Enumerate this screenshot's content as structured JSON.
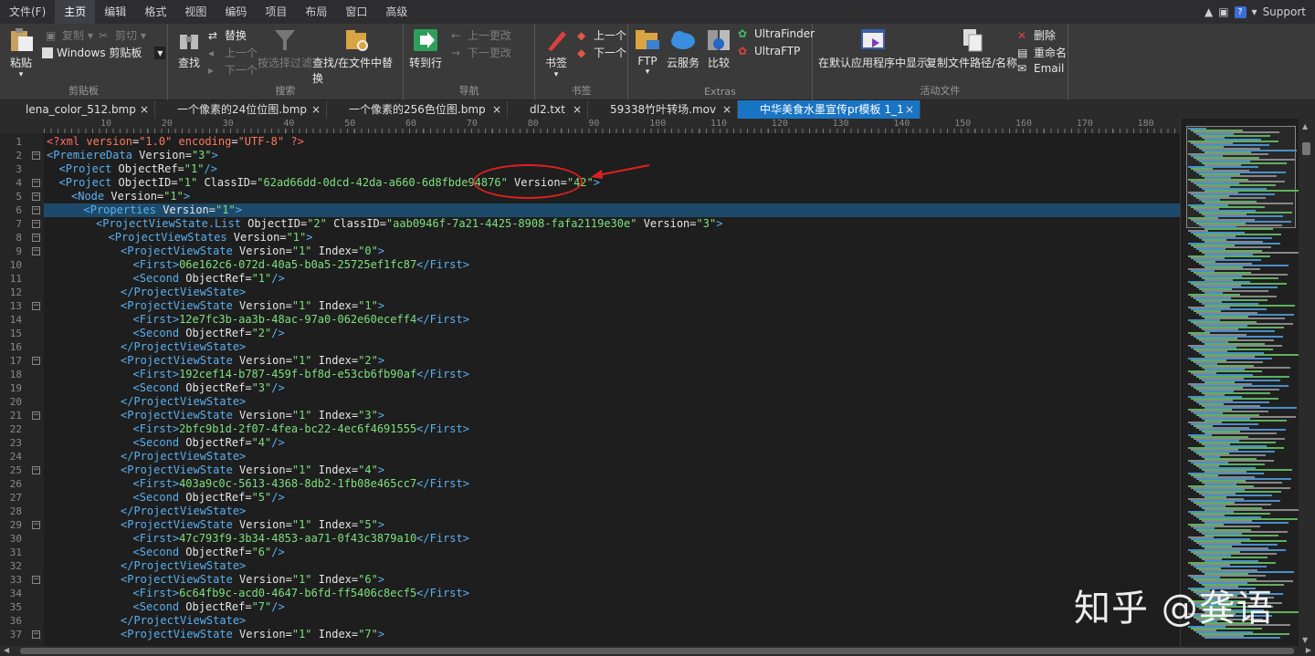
{
  "menu": {
    "items": [
      "文件(F)",
      "主页",
      "编辑",
      "格式",
      "视图",
      "编码",
      "项目",
      "布局",
      "窗口",
      "高级"
    ],
    "active_index": 1,
    "support": "Support"
  },
  "ribbon": {
    "clipboard": {
      "paste": "粘贴",
      "copy": "复制",
      "cut": "剪切",
      "windows_clipboard": "Windows 剪贴板",
      "label": "剪贴板"
    },
    "search": {
      "find": "查找",
      "replace": "替换",
      "prev": "上一个",
      "next": "下一个",
      "filter": "按选择过滤",
      "find_in_files": "查找/在文件中替换",
      "label": "搜索"
    },
    "navigation": {
      "goto": "转到行",
      "prev_change": "上一更改",
      "next_change": "下一更改",
      "label": "导航"
    },
    "bookmarks": {
      "bookmark": "书签",
      "prev": "上一个",
      "next": "下一个",
      "label": "书签"
    },
    "extras": {
      "ftp": "FTP",
      "cloud": "云服务",
      "compare": "比较",
      "ultrafinder": "UltraFinder",
      "ultraftp": "UltraFTP",
      "label": "Extras"
    },
    "active_file": {
      "show_default": "在默认应用程序中显示",
      "copy_path": "复制文件路径/名称",
      "delete": "删除",
      "rename": "重命名",
      "email": "Email",
      "label": "活动文件"
    }
  },
  "tabs": [
    {
      "label": "lena_color_512.bmp",
      "active": false
    },
    {
      "label": "一个像素的24位位图.bmp",
      "active": false
    },
    {
      "label": "一个像素的256色位图.bmp",
      "active": false
    },
    {
      "label": "dl2.txt",
      "active": false
    },
    {
      "label": "59338竹叶转场.mov",
      "active": false
    },
    {
      "label": "中华美食水墨宣传pr模板 1_1",
      "active": true
    }
  ],
  "ruler": [
    "10",
    "20",
    "30",
    "40",
    "50",
    "60",
    "70",
    "80",
    "90",
    "100",
    "110",
    "120",
    "130",
    "140",
    "150",
    "160",
    "170",
    "180"
  ],
  "editor": {
    "current_line": 6,
    "lines": [
      {
        "n": "1",
        "indent": 0,
        "fold": "",
        "tokens": [
          [
            "pi",
            "<?xml "
          ],
          [
            "str",
            "version"
          ],
          [
            "t",
            "="
          ],
          [
            "str",
            "\"1.0\""
          ],
          [
            "t",
            " "
          ],
          [
            "str",
            "encoding"
          ],
          [
            "t",
            "="
          ],
          [
            "str",
            "\"UTF-8\""
          ],
          [
            "pi",
            " ?>"
          ]
        ]
      },
      {
        "n": "2",
        "indent": 0,
        "fold": "−",
        "tokens": [
          [
            "tag",
            "<PremiereData"
          ],
          [
            "t",
            " Version="
          ],
          [
            "val",
            "\"3\""
          ],
          [
            "tag",
            ">"
          ]
        ]
      },
      {
        "n": "3",
        "indent": 1,
        "fold": "",
        "tokens": [
          [
            "tag",
            "<Project"
          ],
          [
            "t",
            " ObjectRef="
          ],
          [
            "val",
            "\"1\""
          ],
          [
            "tag",
            "/>"
          ]
        ]
      },
      {
        "n": "4",
        "indent": 1,
        "fold": "−",
        "tokens": [
          [
            "tag",
            "<Project"
          ],
          [
            "t",
            " ObjectID="
          ],
          [
            "val",
            "\"1\""
          ],
          [
            "t",
            " ClassID="
          ],
          [
            "val",
            "\"62ad66dd-0dcd-42da-a660-6d8fbde94876\""
          ],
          [
            "t",
            " Version="
          ],
          [
            "val",
            "\"42\""
          ],
          [
            "tag",
            ">"
          ]
        ]
      },
      {
        "n": "5",
        "indent": 2,
        "fold": "−",
        "tokens": [
          [
            "tag",
            "<Node"
          ],
          [
            "t",
            " Version="
          ],
          [
            "val",
            "\"1\""
          ],
          [
            "tag",
            ">"
          ]
        ]
      },
      {
        "n": "6",
        "indent": 3,
        "fold": "−",
        "tokens": [
          [
            "tag",
            "<Properties"
          ],
          [
            "t",
            " Version="
          ],
          [
            "val",
            "\"1\""
          ],
          [
            "tag",
            ">"
          ]
        ]
      },
      {
        "n": "7",
        "indent": 4,
        "fold": "−",
        "tokens": [
          [
            "tag",
            "<ProjectViewState.List"
          ],
          [
            "t",
            " ObjectID="
          ],
          [
            "val",
            "\"2\""
          ],
          [
            "t",
            " ClassID="
          ],
          [
            "val",
            "\"aab0946f-7a21-4425-8908-fafa2119e30e\""
          ],
          [
            "t",
            " Version="
          ],
          [
            "val",
            "\"3\""
          ],
          [
            "tag",
            ">"
          ]
        ]
      },
      {
        "n": "8",
        "indent": 5,
        "fold": "−",
        "tokens": [
          [
            "tag",
            "<ProjectViewStates"
          ],
          [
            "t",
            " Version="
          ],
          [
            "val",
            "\"1\""
          ],
          [
            "tag",
            ">"
          ]
        ]
      },
      {
        "n": "9",
        "indent": 6,
        "fold": "−",
        "tokens": [
          [
            "tag",
            "<ProjectViewState"
          ],
          [
            "t",
            " Version="
          ],
          [
            "val",
            "\"1\""
          ],
          [
            "t",
            " Index="
          ],
          [
            "val",
            "\"0\""
          ],
          [
            "tag",
            ">"
          ]
        ]
      },
      {
        "n": "10",
        "indent": 7,
        "fold": "",
        "tokens": [
          [
            "tag",
            "<First>"
          ],
          [
            "val",
            "06e162c6-072d-40a5-b0a5-25725ef1fc87"
          ],
          [
            "tag",
            "</First>"
          ]
        ]
      },
      {
        "n": "11",
        "indent": 7,
        "fold": "",
        "tokens": [
          [
            "tag",
            "<Second"
          ],
          [
            "t",
            " ObjectRef="
          ],
          [
            "val",
            "\"1\""
          ],
          [
            "tag",
            "/>"
          ]
        ]
      },
      {
        "n": "12",
        "indent": 6,
        "fold": "",
        "tokens": [
          [
            "tag",
            "</ProjectViewState>"
          ]
        ]
      },
      {
        "n": "13",
        "indent": 6,
        "fold": "−",
        "tokens": [
          [
            "tag",
            "<ProjectViewState"
          ],
          [
            "t",
            " Version="
          ],
          [
            "val",
            "\"1\""
          ],
          [
            "t",
            " Index="
          ],
          [
            "val",
            "\"1\""
          ],
          [
            "tag",
            ">"
          ]
        ]
      },
      {
        "n": "14",
        "indent": 7,
        "fold": "",
        "tokens": [
          [
            "tag",
            "<First>"
          ],
          [
            "val",
            "12e7fc3b-aa3b-48ac-97a0-062e60eceff4"
          ],
          [
            "tag",
            "</First>"
          ]
        ]
      },
      {
        "n": "15",
        "indent": 7,
        "fold": "",
        "tokens": [
          [
            "tag",
            "<Second"
          ],
          [
            "t",
            " ObjectRef="
          ],
          [
            "val",
            "\"2\""
          ],
          [
            "tag",
            "/>"
          ]
        ]
      },
      {
        "n": "16",
        "indent": 6,
        "fold": "",
        "tokens": [
          [
            "tag",
            "</ProjectViewState>"
          ]
        ]
      },
      {
        "n": "17",
        "indent": 6,
        "fold": "−",
        "tokens": [
          [
            "tag",
            "<ProjectViewState"
          ],
          [
            "t",
            " Version="
          ],
          [
            "val",
            "\"1\""
          ],
          [
            "t",
            " Index="
          ],
          [
            "val",
            "\"2\""
          ],
          [
            "tag",
            ">"
          ]
        ]
      },
      {
        "n": "18",
        "indent": 7,
        "fold": "",
        "tokens": [
          [
            "tag",
            "<First>"
          ],
          [
            "val",
            "192cef14-b787-459f-bf8d-e53cb6fb90af"
          ],
          [
            "tag",
            "</First>"
          ]
        ]
      },
      {
        "n": "19",
        "indent": 7,
        "fold": "",
        "tokens": [
          [
            "tag",
            "<Second"
          ],
          [
            "t",
            " ObjectRef="
          ],
          [
            "val",
            "\"3\""
          ],
          [
            "tag",
            "/>"
          ]
        ]
      },
      {
        "n": "20",
        "indent": 6,
        "fold": "",
        "tokens": [
          [
            "tag",
            "</ProjectViewState>"
          ]
        ]
      },
      {
        "n": "21",
        "indent": 6,
        "fold": "−",
        "tokens": [
          [
            "tag",
            "<ProjectViewState"
          ],
          [
            "t",
            " Version="
          ],
          [
            "val",
            "\"1\""
          ],
          [
            "t",
            " Index="
          ],
          [
            "val",
            "\"3\""
          ],
          [
            "tag",
            ">"
          ]
        ]
      },
      {
        "n": "22",
        "indent": 7,
        "fold": "",
        "tokens": [
          [
            "tag",
            "<First>"
          ],
          [
            "val",
            "2bfc9b1d-2f07-4fea-bc22-4ec6f4691555"
          ],
          [
            "tag",
            "</First>"
          ]
        ]
      },
      {
        "n": "23",
        "indent": 7,
        "fold": "",
        "tokens": [
          [
            "tag",
            "<Second"
          ],
          [
            "t",
            " ObjectRef="
          ],
          [
            "val",
            "\"4\""
          ],
          [
            "tag",
            "/>"
          ]
        ]
      },
      {
        "n": "24",
        "indent": 6,
        "fold": "",
        "tokens": [
          [
            "tag",
            "</ProjectViewState>"
          ]
        ]
      },
      {
        "n": "25",
        "indent": 6,
        "fold": "−",
        "tokens": [
          [
            "tag",
            "<ProjectViewState"
          ],
          [
            "t",
            " Version="
          ],
          [
            "val",
            "\"1\""
          ],
          [
            "t",
            " Index="
          ],
          [
            "val",
            "\"4\""
          ],
          [
            "tag",
            ">"
          ]
        ]
      },
      {
        "n": "26",
        "indent": 7,
        "fold": "",
        "tokens": [
          [
            "tag",
            "<First>"
          ],
          [
            "val",
            "403a9c0c-5613-4368-8db2-1fb08e465cc7"
          ],
          [
            "tag",
            "</First>"
          ]
        ]
      },
      {
        "n": "27",
        "indent": 7,
        "fold": "",
        "tokens": [
          [
            "tag",
            "<Second"
          ],
          [
            "t",
            " ObjectRef="
          ],
          [
            "val",
            "\"5\""
          ],
          [
            "tag",
            "/>"
          ]
        ]
      },
      {
        "n": "28",
        "indent": 6,
        "fold": "",
        "tokens": [
          [
            "tag",
            "</ProjectViewState>"
          ]
        ]
      },
      {
        "n": "29",
        "indent": 6,
        "fold": "−",
        "tokens": [
          [
            "tag",
            "<ProjectViewState"
          ],
          [
            "t",
            " Version="
          ],
          [
            "val",
            "\"1\""
          ],
          [
            "t",
            " Index="
          ],
          [
            "val",
            "\"5\""
          ],
          [
            "tag",
            ">"
          ]
        ]
      },
      {
        "n": "30",
        "indent": 7,
        "fold": "",
        "tokens": [
          [
            "tag",
            "<First>"
          ],
          [
            "val",
            "47c793f9-3b34-4853-aa71-0f43c3879a10"
          ],
          [
            "tag",
            "</First>"
          ]
        ]
      },
      {
        "n": "31",
        "indent": 7,
        "fold": "",
        "tokens": [
          [
            "tag",
            "<Second"
          ],
          [
            "t",
            " ObjectRef="
          ],
          [
            "val",
            "\"6\""
          ],
          [
            "tag",
            "/>"
          ]
        ]
      },
      {
        "n": "32",
        "indent": 6,
        "fold": "",
        "tokens": [
          [
            "tag",
            "</ProjectViewState>"
          ]
        ]
      },
      {
        "n": "33",
        "indent": 6,
        "fold": "−",
        "tokens": [
          [
            "tag",
            "<ProjectViewState"
          ],
          [
            "t",
            " Version="
          ],
          [
            "val",
            "\"1\""
          ],
          [
            "t",
            " Index="
          ],
          [
            "val",
            "\"6\""
          ],
          [
            "tag",
            ">"
          ]
        ]
      },
      {
        "n": "34",
        "indent": 7,
        "fold": "",
        "tokens": [
          [
            "tag",
            "<First>"
          ],
          [
            "val",
            "6c64fb9c-acd0-4647-b6fd-ff5406c8ecf5"
          ],
          [
            "tag",
            "</First>"
          ]
        ]
      },
      {
        "n": "35",
        "indent": 7,
        "fold": "",
        "tokens": [
          [
            "tag",
            "<Second"
          ],
          [
            "t",
            " ObjectRef="
          ],
          [
            "val",
            "\"7\""
          ],
          [
            "tag",
            "/>"
          ]
        ]
      },
      {
        "n": "36",
        "indent": 6,
        "fold": "",
        "tokens": [
          [
            "tag",
            "</ProjectViewState>"
          ]
        ]
      },
      {
        "n": "37",
        "indent": 6,
        "fold": "−",
        "tokens": [
          [
            "tag",
            "<ProjectViewState"
          ],
          [
            "t",
            " Version="
          ],
          [
            "val",
            "\"1\""
          ],
          [
            "t",
            " Index="
          ],
          [
            "val",
            "\"7\""
          ],
          [
            "tag",
            ">"
          ]
        ]
      }
    ]
  },
  "watermark": "知乎 @龚语",
  "colors": {
    "accent": "#1a74c4",
    "annotation": "#e02020",
    "tag": "#5ab0f0",
    "value": "#7ee07e"
  }
}
